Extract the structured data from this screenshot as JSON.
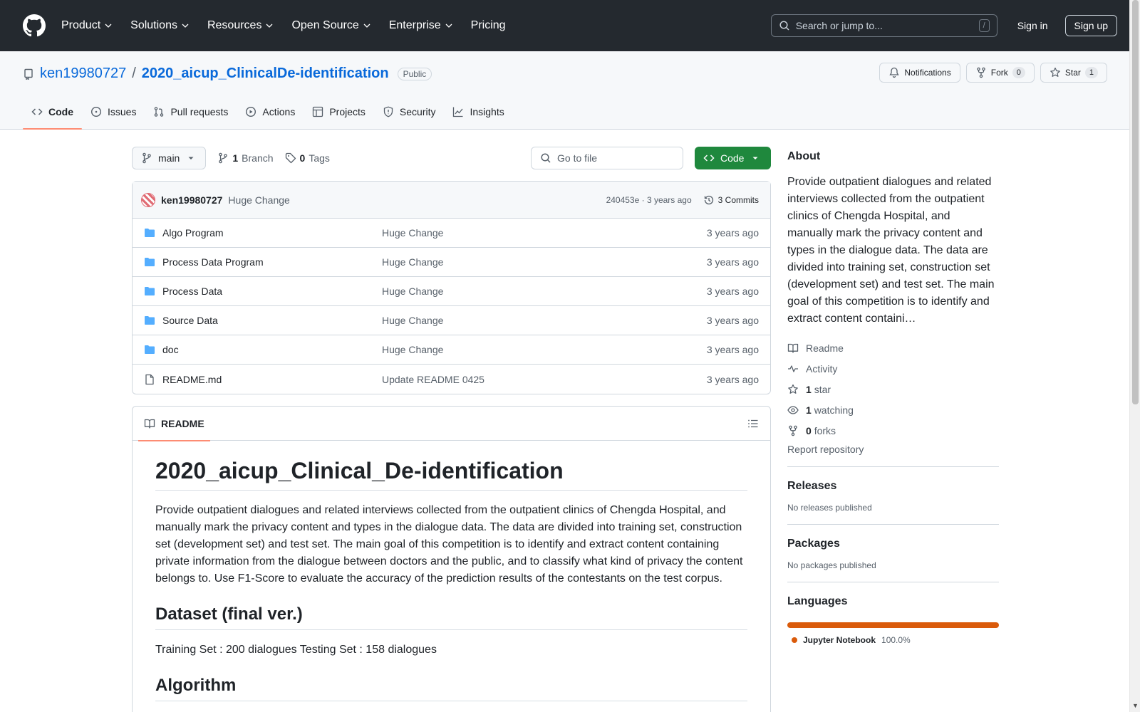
{
  "header": {
    "nav": [
      "Product",
      "Solutions",
      "Resources",
      "Open Source",
      "Enterprise",
      "Pricing"
    ],
    "search_placeholder": "Search or jump to...",
    "search_kbd": "/",
    "signin": "Sign in",
    "signup": "Sign up"
  },
  "repo": {
    "owner": "ken19980727",
    "separator": "/",
    "name": "2020_aicup_ClinicalDe-identification",
    "visibility": "Public",
    "actions": {
      "notifications": "Notifications",
      "fork": "Fork",
      "fork_count": "0",
      "star": "Star",
      "star_count": "1"
    },
    "tabs": [
      "Code",
      "Issues",
      "Pull requests",
      "Actions",
      "Projects",
      "Security",
      "Insights"
    ]
  },
  "toolbar": {
    "branch": "main",
    "branch_count": "1",
    "branch_label": "Branch",
    "tag_count": "0",
    "tag_label": "Tags",
    "goto_placeholder": "Go to file",
    "code_button": "Code"
  },
  "commit": {
    "author": "ken19980727",
    "message": "Huge Change",
    "meta": "240453e · 3 years ago",
    "commits": "3 Commits"
  },
  "files": [
    {
      "name": "Algo Program",
      "type": "folder",
      "message": "Huge Change",
      "date": "3 years ago"
    },
    {
      "name": "Process Data Program",
      "type": "folder",
      "message": "Huge Change",
      "date": "3 years ago"
    },
    {
      "name": "Process Data",
      "type": "folder",
      "message": "Huge Change",
      "date": "3 years ago"
    },
    {
      "name": "Source Data",
      "type": "folder",
      "message": "Huge Change",
      "date": "3 years ago"
    },
    {
      "name": "doc",
      "type": "folder",
      "message": "Huge Change",
      "date": "3 years ago"
    },
    {
      "name": "README.md",
      "type": "file",
      "message": "Update README 0425",
      "date": "3 years ago"
    }
  ],
  "readme": {
    "tab": "README",
    "title": "2020_aicup_Clinical_De-identification",
    "intro": "Provide outpatient dialogues and related interviews collected from the outpatient clinics of Chengda Hospital, and manually mark the privacy content and types in the dialogue data. The data are divided into training set, construction set (development set) and test set. The main goal of this competition is to identify and extract content containing private information from the dialogue between doctors and the public, and to classify what kind of privacy the content belongs to. Use F1-Score to evaluate the accuracy of the prediction results of the contestants on the test corpus.",
    "h_dataset": "Dataset (final ver.)",
    "dataset_text": "Training Set : 200 dialogues Testing Set : 158 dialogues",
    "h_algorithm": "Algorithm"
  },
  "about": {
    "title": "About",
    "description": "Provide outpatient dialogues and related interviews collected from the outpatient clinics of Chengda Hospital, and manually mark the privacy content and types in the dialogue data. The data are divided into training set, construction set (development set) and test set. The main goal of this competition is to identify and extract content containi…",
    "readme": "Readme",
    "activity": "Activity",
    "stars_count": "1",
    "stars_label": "star",
    "watching_count": "1",
    "watching_label": "watching",
    "forks_count": "0",
    "forks_label": "forks",
    "report": "Report repository"
  },
  "releases": {
    "title": "Releases",
    "empty": "No releases published"
  },
  "packages": {
    "title": "Packages",
    "empty": "No packages published"
  },
  "languages": {
    "title": "Languages",
    "items": [
      {
        "name": "Jupyter Notebook",
        "percent": "100.0%",
        "color": "#da5b0b",
        "fraction": 1.0
      }
    ]
  },
  "colors": {
    "accent": "#0969da",
    "code_button": "#1f883d",
    "tab_underline": "#fd8c73",
    "folder": "#54aeff"
  }
}
